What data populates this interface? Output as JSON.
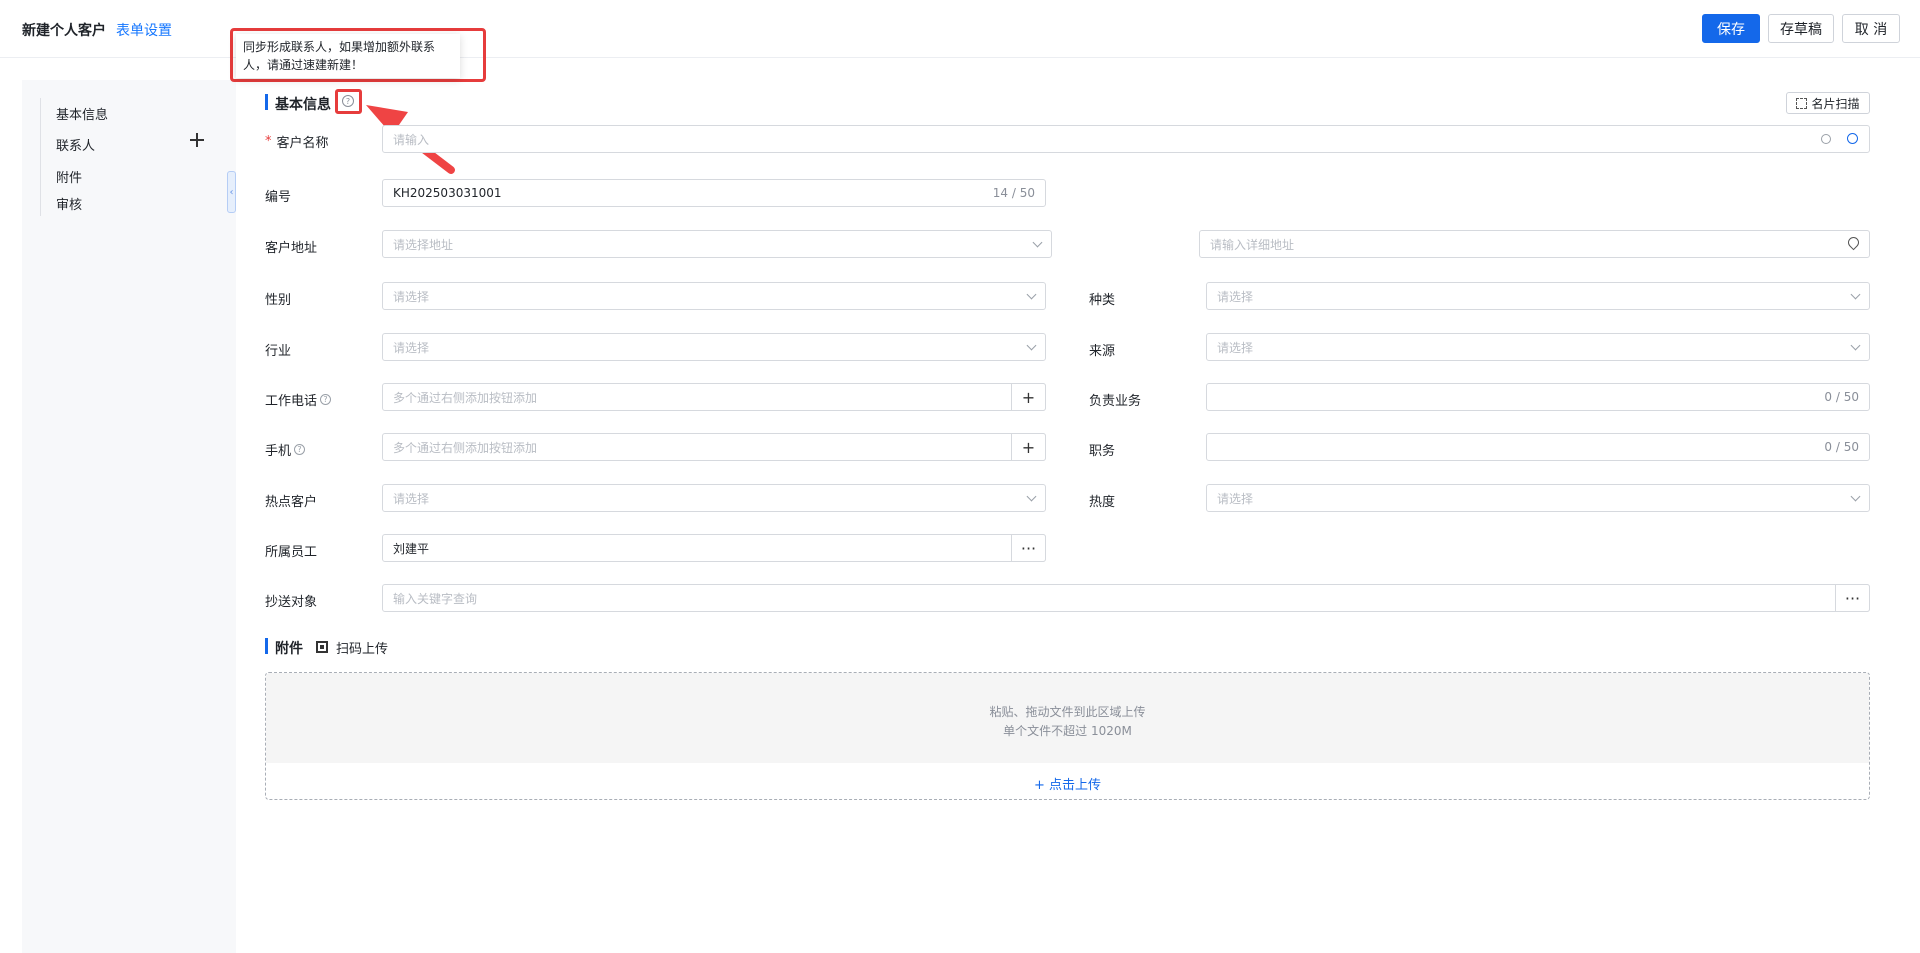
{
  "header": {
    "title": "新建个人客户",
    "form_settings": "表单设置",
    "save": "保存",
    "draft": "存草稿",
    "cancel": "取 消"
  },
  "sidebar": {
    "items": [
      "基本信息",
      "联系人",
      "附件",
      "审核"
    ]
  },
  "tooltip": {
    "text": "同步形成联系人，如果增加额外联系人，请通过速建新建！"
  },
  "section_basic": {
    "title": "基本信息",
    "scan_card": "名片扫描"
  },
  "fields": {
    "customer_name": {
      "label": "客户名称",
      "required_mark": "*",
      "placeholder": "请输入"
    },
    "code": {
      "label": "编号",
      "value": "KH202503031001",
      "count": "14 / 50"
    },
    "address": {
      "label": "客户地址",
      "placeholder": "请选择地址",
      "detail_placeholder": "请输入详细地址"
    },
    "gender": {
      "label": "性别",
      "placeholder": "请选择"
    },
    "category": {
      "label": "种类",
      "placeholder": "请选择"
    },
    "industry": {
      "label": "行业",
      "placeholder": "请选择"
    },
    "source": {
      "label": "来源",
      "placeholder": "请选择"
    },
    "work_phone": {
      "label": "工作电话",
      "placeholder": "多个通过右侧添加按钮添加",
      "addon": "+"
    },
    "business": {
      "label": "负责业务",
      "count": "0 / 50"
    },
    "mobile": {
      "label": "手机",
      "placeholder": "多个通过右侧添加按钮添加",
      "addon": "+"
    },
    "position": {
      "label": "职务",
      "count": "0 / 50"
    },
    "hot_customer": {
      "label": "热点客户",
      "placeholder": "请选择"
    },
    "heat": {
      "label": "热度",
      "placeholder": "请选择"
    },
    "employee": {
      "label": "所属员工",
      "value": "刘建平",
      "addon": "···"
    },
    "cc": {
      "label": "抄送对象",
      "placeholder": "输入关键字查询",
      "addon": "···"
    }
  },
  "section_attach": {
    "title": "附件",
    "scan_upload": "扫码上传",
    "drop_text": "粘贴、拖动文件到此区域上传",
    "limit_text": "单个文件不超过 1020M",
    "click_upload": "+ 点击上传"
  }
}
